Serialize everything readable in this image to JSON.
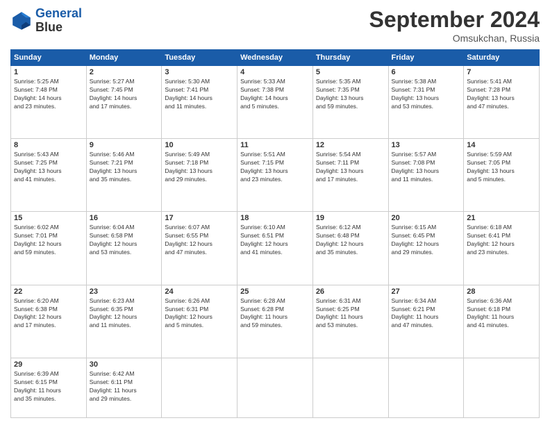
{
  "header": {
    "logo_line1": "General",
    "logo_line2": "Blue",
    "month_title": "September 2024",
    "location": "Omsukchan, Russia"
  },
  "days_of_week": [
    "Sunday",
    "Monday",
    "Tuesday",
    "Wednesday",
    "Thursday",
    "Friday",
    "Saturday"
  ],
  "weeks": [
    [
      {
        "day": "1",
        "lines": [
          "Sunrise: 5:25 AM",
          "Sunset: 7:48 PM",
          "Daylight: 14 hours",
          "and 23 minutes."
        ]
      },
      {
        "day": "2",
        "lines": [
          "Sunrise: 5:27 AM",
          "Sunset: 7:45 PM",
          "Daylight: 14 hours",
          "and 17 minutes."
        ]
      },
      {
        "day": "3",
        "lines": [
          "Sunrise: 5:30 AM",
          "Sunset: 7:41 PM",
          "Daylight: 14 hours",
          "and 11 minutes."
        ]
      },
      {
        "day": "4",
        "lines": [
          "Sunrise: 5:33 AM",
          "Sunset: 7:38 PM",
          "Daylight: 14 hours",
          "and 5 minutes."
        ]
      },
      {
        "day": "5",
        "lines": [
          "Sunrise: 5:35 AM",
          "Sunset: 7:35 PM",
          "Daylight: 13 hours",
          "and 59 minutes."
        ]
      },
      {
        "day": "6",
        "lines": [
          "Sunrise: 5:38 AM",
          "Sunset: 7:31 PM",
          "Daylight: 13 hours",
          "and 53 minutes."
        ]
      },
      {
        "day": "7",
        "lines": [
          "Sunrise: 5:41 AM",
          "Sunset: 7:28 PM",
          "Daylight: 13 hours",
          "and 47 minutes."
        ]
      }
    ],
    [
      {
        "day": "8",
        "lines": [
          "Sunrise: 5:43 AM",
          "Sunset: 7:25 PM",
          "Daylight: 13 hours",
          "and 41 minutes."
        ]
      },
      {
        "day": "9",
        "lines": [
          "Sunrise: 5:46 AM",
          "Sunset: 7:21 PM",
          "Daylight: 13 hours",
          "and 35 minutes."
        ]
      },
      {
        "day": "10",
        "lines": [
          "Sunrise: 5:49 AM",
          "Sunset: 7:18 PM",
          "Daylight: 13 hours",
          "and 29 minutes."
        ]
      },
      {
        "day": "11",
        "lines": [
          "Sunrise: 5:51 AM",
          "Sunset: 7:15 PM",
          "Daylight: 13 hours",
          "and 23 minutes."
        ]
      },
      {
        "day": "12",
        "lines": [
          "Sunrise: 5:54 AM",
          "Sunset: 7:11 PM",
          "Daylight: 13 hours",
          "and 17 minutes."
        ]
      },
      {
        "day": "13",
        "lines": [
          "Sunrise: 5:57 AM",
          "Sunset: 7:08 PM",
          "Daylight: 13 hours",
          "and 11 minutes."
        ]
      },
      {
        "day": "14",
        "lines": [
          "Sunrise: 5:59 AM",
          "Sunset: 7:05 PM",
          "Daylight: 13 hours",
          "and 5 minutes."
        ]
      }
    ],
    [
      {
        "day": "15",
        "lines": [
          "Sunrise: 6:02 AM",
          "Sunset: 7:01 PM",
          "Daylight: 12 hours",
          "and 59 minutes."
        ]
      },
      {
        "day": "16",
        "lines": [
          "Sunrise: 6:04 AM",
          "Sunset: 6:58 PM",
          "Daylight: 12 hours",
          "and 53 minutes."
        ]
      },
      {
        "day": "17",
        "lines": [
          "Sunrise: 6:07 AM",
          "Sunset: 6:55 PM",
          "Daylight: 12 hours",
          "and 47 minutes."
        ]
      },
      {
        "day": "18",
        "lines": [
          "Sunrise: 6:10 AM",
          "Sunset: 6:51 PM",
          "Daylight: 12 hours",
          "and 41 minutes."
        ]
      },
      {
        "day": "19",
        "lines": [
          "Sunrise: 6:12 AM",
          "Sunset: 6:48 PM",
          "Daylight: 12 hours",
          "and 35 minutes."
        ]
      },
      {
        "day": "20",
        "lines": [
          "Sunrise: 6:15 AM",
          "Sunset: 6:45 PM",
          "Daylight: 12 hours",
          "and 29 minutes."
        ]
      },
      {
        "day": "21",
        "lines": [
          "Sunrise: 6:18 AM",
          "Sunset: 6:41 PM",
          "Daylight: 12 hours",
          "and 23 minutes."
        ]
      }
    ],
    [
      {
        "day": "22",
        "lines": [
          "Sunrise: 6:20 AM",
          "Sunset: 6:38 PM",
          "Daylight: 12 hours",
          "and 17 minutes."
        ]
      },
      {
        "day": "23",
        "lines": [
          "Sunrise: 6:23 AM",
          "Sunset: 6:35 PM",
          "Daylight: 12 hours",
          "and 11 minutes."
        ]
      },
      {
        "day": "24",
        "lines": [
          "Sunrise: 6:26 AM",
          "Sunset: 6:31 PM",
          "Daylight: 12 hours",
          "and 5 minutes."
        ]
      },
      {
        "day": "25",
        "lines": [
          "Sunrise: 6:28 AM",
          "Sunset: 6:28 PM",
          "Daylight: 11 hours",
          "and 59 minutes."
        ]
      },
      {
        "day": "26",
        "lines": [
          "Sunrise: 6:31 AM",
          "Sunset: 6:25 PM",
          "Daylight: 11 hours",
          "and 53 minutes."
        ]
      },
      {
        "day": "27",
        "lines": [
          "Sunrise: 6:34 AM",
          "Sunset: 6:21 PM",
          "Daylight: 11 hours",
          "and 47 minutes."
        ]
      },
      {
        "day": "28",
        "lines": [
          "Sunrise: 6:36 AM",
          "Sunset: 6:18 PM",
          "Daylight: 11 hours",
          "and 41 minutes."
        ]
      }
    ],
    [
      {
        "day": "29",
        "lines": [
          "Sunrise: 6:39 AM",
          "Sunset: 6:15 PM",
          "Daylight: 11 hours",
          "and 35 minutes."
        ]
      },
      {
        "day": "30",
        "lines": [
          "Sunrise: 6:42 AM",
          "Sunset: 6:11 PM",
          "Daylight: 11 hours",
          "and 29 minutes."
        ]
      },
      null,
      null,
      null,
      null,
      null
    ]
  ]
}
